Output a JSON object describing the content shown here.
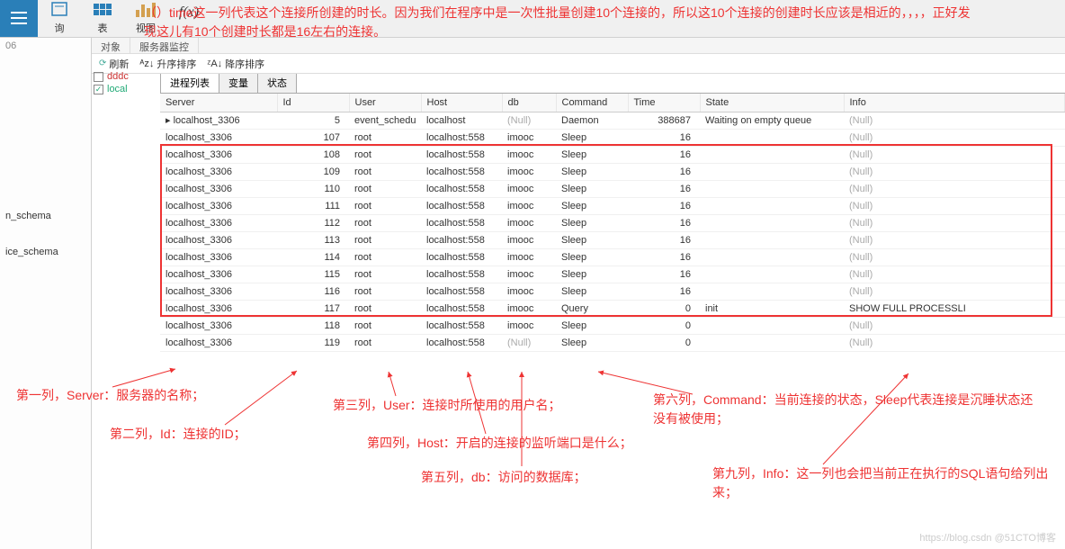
{
  "toolbar": {
    "query_label": "询",
    "table_label": "表",
    "view_label": "视图",
    "fx_label": "f(x)"
  },
  "port_value": "06",
  "panels": {
    "object_label": "对象",
    "service_label": "服务器监控",
    "refresh_label": "刷新",
    "sort_asc_label": "升序排序",
    "sort_desc_label": "降序排序",
    "tab_process": "进程列表",
    "tab_vars": "变量",
    "tab_status": "状态"
  },
  "tree": {
    "dddc": "dddc",
    "local": "local"
  },
  "schemas": [
    "n_schema",
    "ice_schema"
  ],
  "columns": [
    "Server",
    "Id",
    "User",
    "Host",
    "db",
    "Command",
    "Time",
    "State",
    "Info"
  ],
  "rows": [
    {
      "server": "localhost_3306",
      "id": 5,
      "user": "event_schedu",
      "host": "localhost",
      "db": "(Null)",
      "cmd": "Daemon",
      "time": 388687,
      "state": "Waiting on empty queue",
      "info": "(Null)",
      "marker": "▸"
    },
    {
      "server": "localhost_3306",
      "id": 107,
      "user": "root",
      "host": "localhost:558",
      "db": "imooc",
      "cmd": "Sleep",
      "time": 16,
      "state": "",
      "info": "(Null)"
    },
    {
      "server": "localhost_3306",
      "id": 108,
      "user": "root",
      "host": "localhost:558",
      "db": "imooc",
      "cmd": "Sleep",
      "time": 16,
      "state": "",
      "info": "(Null)"
    },
    {
      "server": "localhost_3306",
      "id": 109,
      "user": "root",
      "host": "localhost:558",
      "db": "imooc",
      "cmd": "Sleep",
      "time": 16,
      "state": "",
      "info": "(Null)"
    },
    {
      "server": "localhost_3306",
      "id": 110,
      "user": "root",
      "host": "localhost:558",
      "db": "imooc",
      "cmd": "Sleep",
      "time": 16,
      "state": "",
      "info": "(Null)"
    },
    {
      "server": "localhost_3306",
      "id": 111,
      "user": "root",
      "host": "localhost:558",
      "db": "imooc",
      "cmd": "Sleep",
      "time": 16,
      "state": "",
      "info": "(Null)"
    },
    {
      "server": "localhost_3306",
      "id": 112,
      "user": "root",
      "host": "localhost:558",
      "db": "imooc",
      "cmd": "Sleep",
      "time": 16,
      "state": "",
      "info": "(Null)"
    },
    {
      "server": "localhost_3306",
      "id": 113,
      "user": "root",
      "host": "localhost:558",
      "db": "imooc",
      "cmd": "Sleep",
      "time": 16,
      "state": "",
      "info": "(Null)"
    },
    {
      "server": "localhost_3306",
      "id": 114,
      "user": "root",
      "host": "localhost:558",
      "db": "imooc",
      "cmd": "Sleep",
      "time": 16,
      "state": "",
      "info": "(Null)"
    },
    {
      "server": "localhost_3306",
      "id": 115,
      "user": "root",
      "host": "localhost:558",
      "db": "imooc",
      "cmd": "Sleep",
      "time": 16,
      "state": "",
      "info": "(Null)"
    },
    {
      "server": "localhost_3306",
      "id": 116,
      "user": "root",
      "host": "localhost:558",
      "db": "imooc",
      "cmd": "Sleep",
      "time": 16,
      "state": "",
      "info": "(Null)"
    },
    {
      "server": "localhost_3306",
      "id": 117,
      "user": "root",
      "host": "localhost:558",
      "db": "imooc",
      "cmd": "Query",
      "time": 0,
      "state": "init",
      "info": "SHOW FULL PROCESSLI"
    },
    {
      "server": "localhost_3306",
      "id": 118,
      "user": "root",
      "host": "localhost:558",
      "db": "imooc",
      "cmd": "Sleep",
      "time": 0,
      "state": "",
      "info": "(Null)"
    },
    {
      "server": "localhost_3306",
      "id": 119,
      "user": "root",
      "host": "localhost:558",
      "db": "(Null)",
      "cmd": "Sleep",
      "time": 0,
      "state": "",
      "info": "(Null)"
    }
  ],
  "annotations": {
    "top": "（）time这一列代表这个连接所创建的时长。因为我们在程序中是一次性批量创建10个连接的，所以这10个连接的创建时长应该是相近的，，，，正好发现这儿有10个创建时长都是16左右的连接。",
    "col1": "第一列，Server：服务器的名称；",
    "col2": "第二列，Id：连接的ID；",
    "col3": "第三列，User：连接时所使用的用户名；",
    "col4": "第四列，Host：开启的连接的监听端口是什么；",
    "col5": "第五列，db：访问的数据库；",
    "col6": "第六列，Command：当前连接的状态，Sleep代表连接是沉睡状态还没有被使用；",
    "col9": "第九列，Info：这一列也会把当前正在执行的SQL语句给列出来；"
  },
  "watermark": "https://blog.csdn @51CTO博客"
}
